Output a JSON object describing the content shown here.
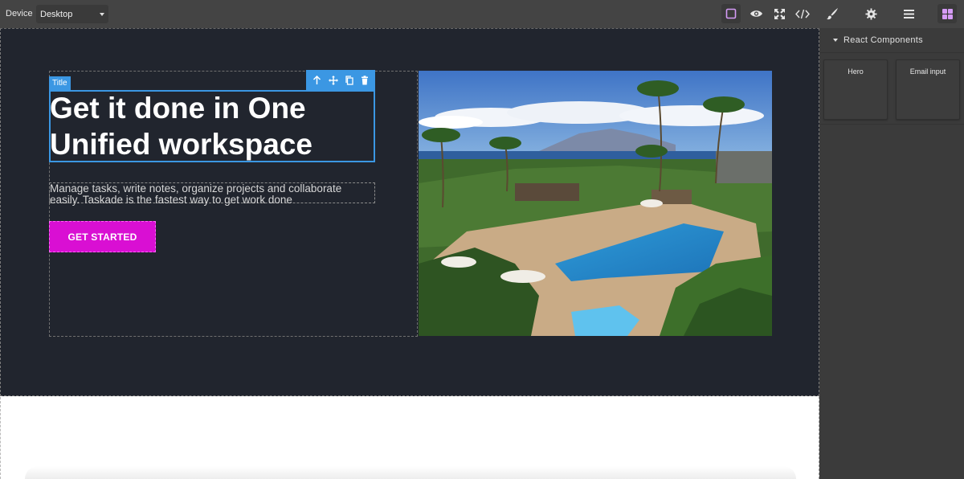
{
  "toolbar": {
    "device_label": "Device",
    "device_value": "Desktop",
    "accent_color": "#d59bf6",
    "buttons": [
      {
        "name": "sw-visibility",
        "icon": "square-outline-icon",
        "active": true
      },
      {
        "name": "preview",
        "icon": "eye-icon"
      },
      {
        "name": "fullscreen",
        "icon": "arrows-expand-icon"
      },
      {
        "name": "export-code",
        "icon": "code-icon"
      }
    ],
    "panel_buttons": [
      {
        "name": "style-manager",
        "icon": "paint-brush-icon"
      },
      {
        "name": "settings",
        "icon": "gear-icon"
      },
      {
        "name": "layer-manager",
        "icon": "bars-icon"
      },
      {
        "name": "blocks",
        "icon": "grid-icon",
        "active": true
      }
    ]
  },
  "canvas": {
    "hero": {
      "selected_tag": "Title",
      "title": "Get it done in One Unified workspace",
      "subtitle": "Manage tasks, write notes, organize projects and collaborate easily. Taskade is the fastest way to get work done",
      "cta_label": "GET STARTED",
      "cta_color": "#d90fd3",
      "background_color": "#21252e",
      "selection_color": "#3b97e3",
      "tools": [
        "arrow-up-icon",
        "move-icon",
        "copy-icon",
        "trash-icon"
      ]
    }
  },
  "panel": {
    "section_title": "React Components",
    "blocks": [
      {
        "label": "Hero"
      },
      {
        "label": "Email input"
      }
    ]
  }
}
